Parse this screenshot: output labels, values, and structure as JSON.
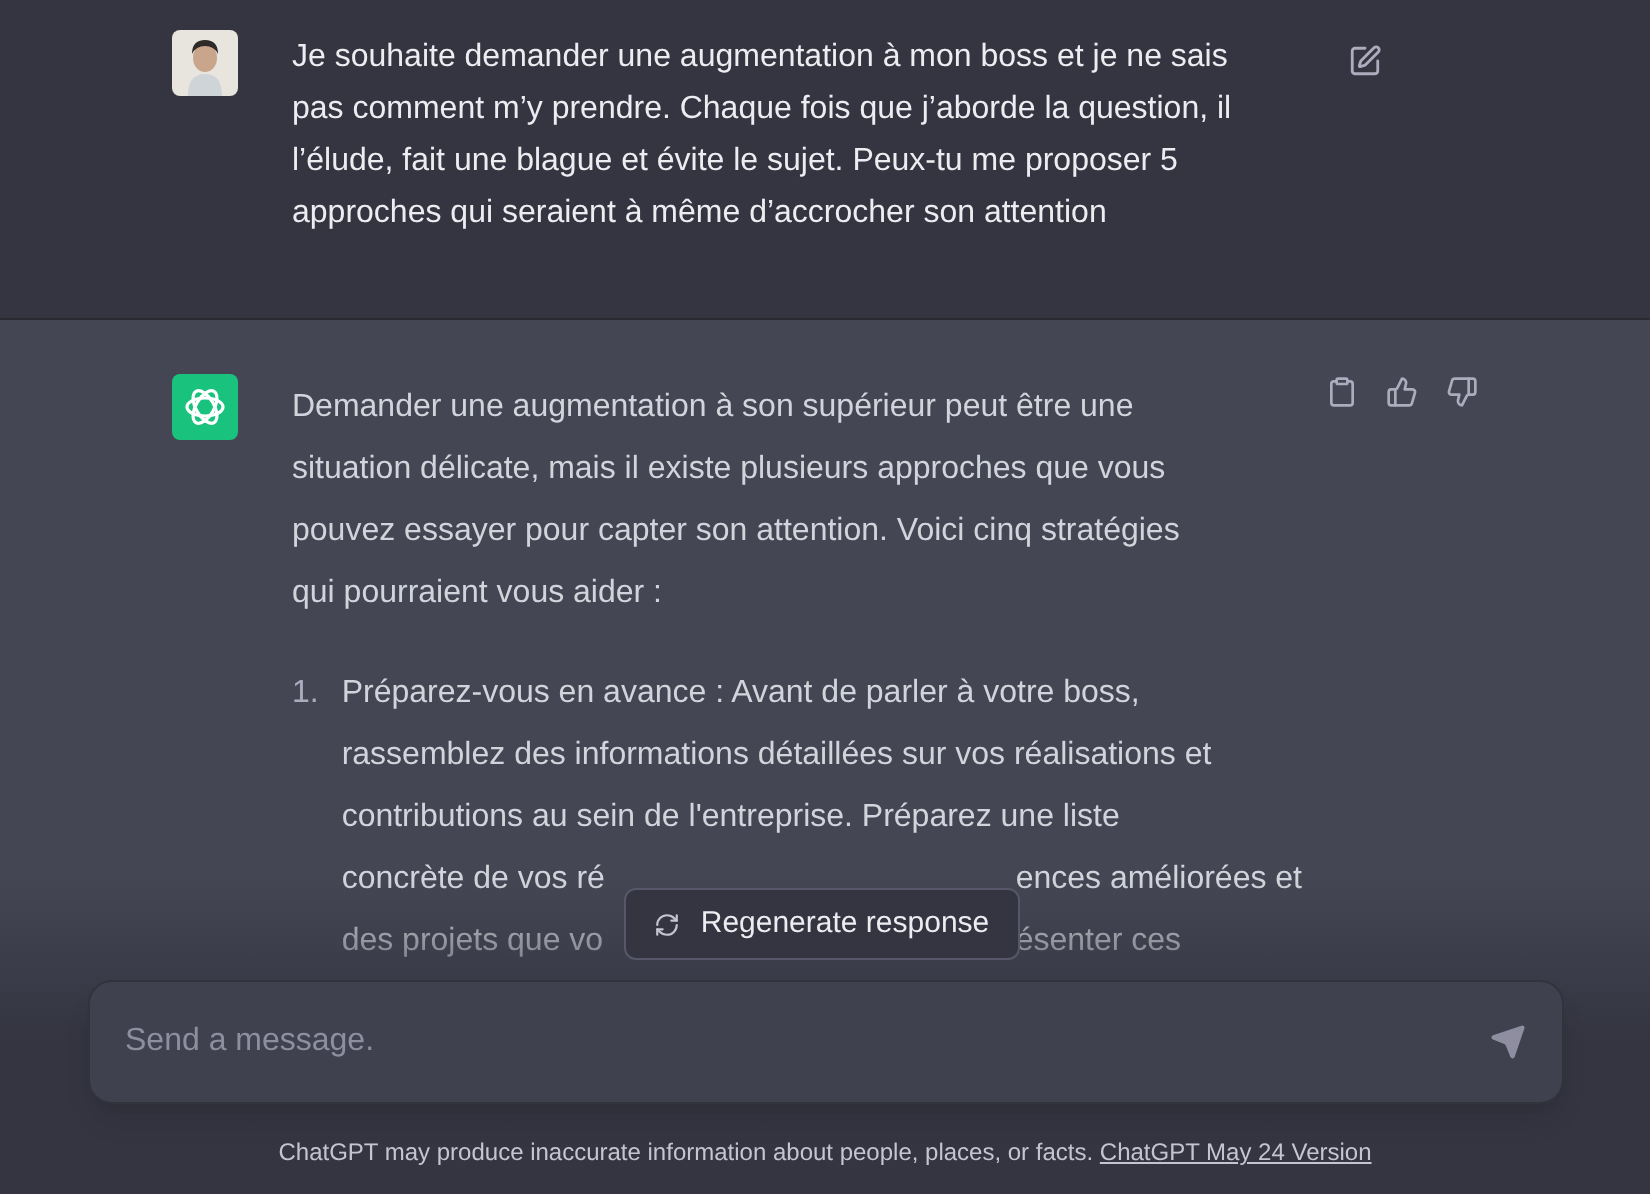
{
  "user_message": {
    "text": "Je souhaite demander une augmentation à mon boss et je ne sais pas comment m’y prendre. Chaque fois que j’aborde la question, il l’élude, fait une blague et évite le sujet. Peux-tu me proposer 5 approches qui seraient à même d’accrocher son attention"
  },
  "assistant_message": {
    "intro": "Demander une augmentation à son supérieur peut être une situation délicate, mais il existe plusieurs approches que vous pouvez essayer pour capter son attention. Voici cinq stratégies qui pourraient vous aider :",
    "list": [
      {
        "number": "1.",
        "lines": [
          [
            "Préparez-vous en avance : Avant de parler à votre boss,"
          ],
          [
            "rassemblez des informations détaillées sur vos réalisations et"
          ],
          [
            "contributions au sein de l'entreprise. Préparez une liste"
          ],
          [
            "concrète de vos ré",
            "ences améliorées et"
          ],
          [
            "des projets que vo",
            "ésenter ces"
          ]
        ]
      }
    ]
  },
  "regenerate_button": {
    "label": "Regenerate response"
  },
  "composer": {
    "placeholder": "Send a message."
  },
  "footer": {
    "text": "ChatGPT may produce inaccurate information about people, places, or facts.",
    "link": "ChatGPT May 24 Version"
  }
}
